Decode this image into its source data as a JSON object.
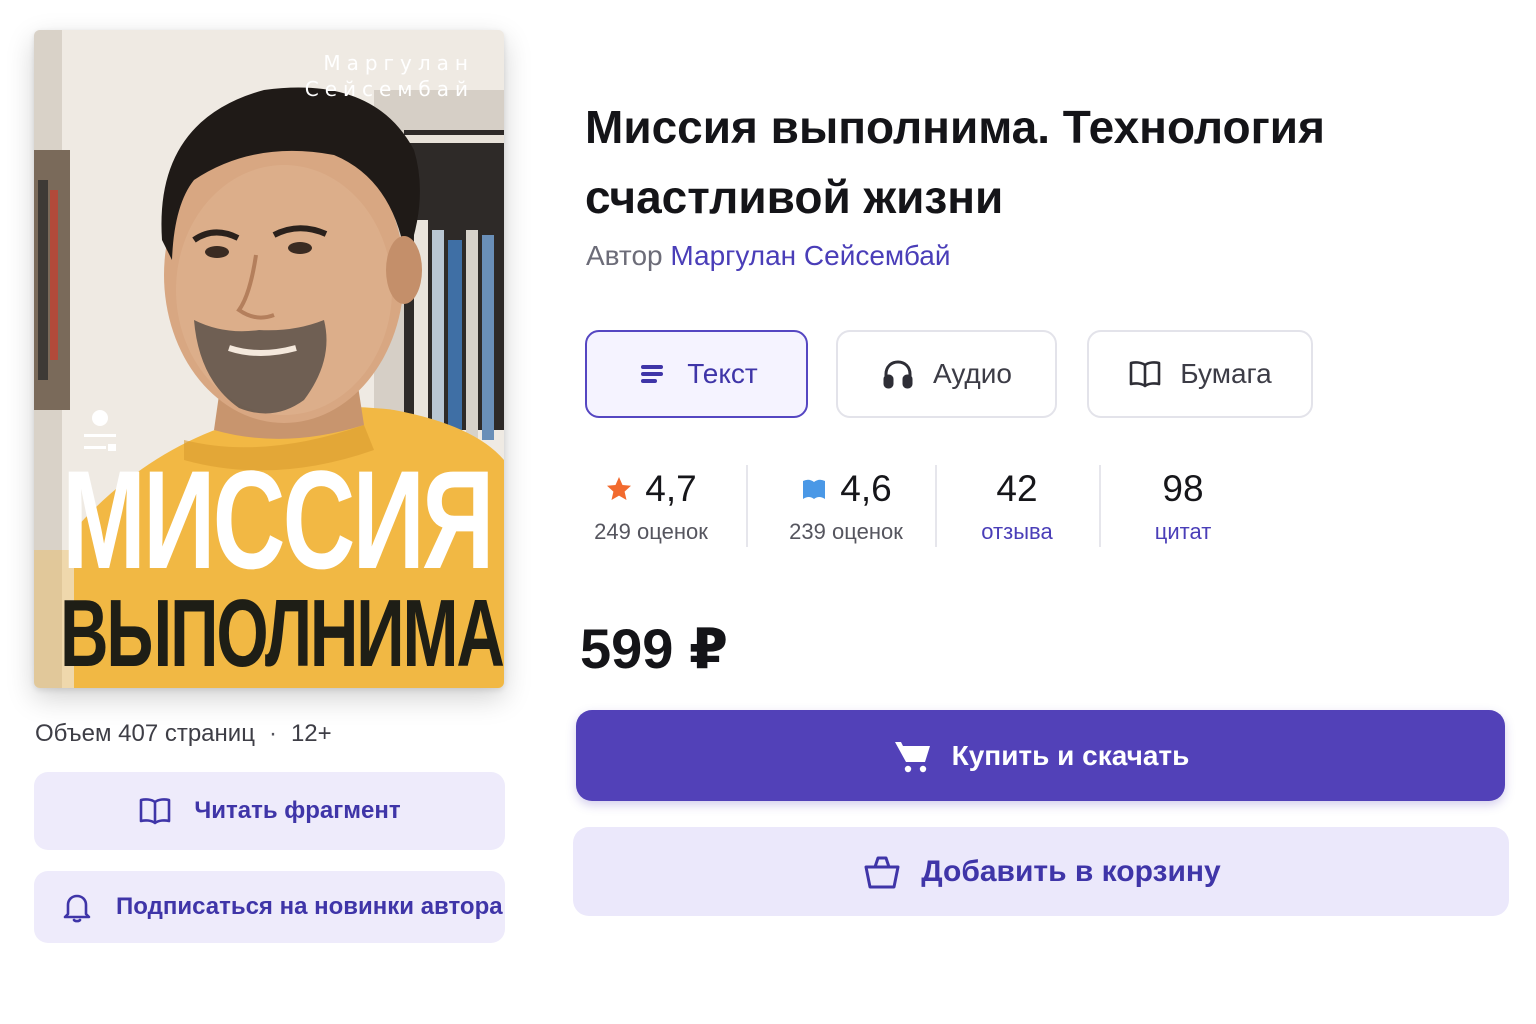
{
  "book": {
    "title": "Миссия выполнима. Технология счастливой жизни",
    "author_prefix": "Автор",
    "author_name": "Маргулан Сейсембай"
  },
  "cover": {
    "author_line_1": "Маргулан",
    "author_line_2": "Сейсембай",
    "title_line_1": "МИССИЯ",
    "title_line_2": "ВЫПОЛНИМА",
    "background_color": "#f2b844"
  },
  "meta": {
    "volume": "Объем 407 страниц",
    "separator": "·",
    "age_rating": "12+"
  },
  "side_actions": {
    "read_fragment": "Читать фрагмент",
    "subscribe": "Подписаться на новинки автора"
  },
  "formats": [
    {
      "label": "Текст",
      "icon": "lines-icon",
      "selected": true
    },
    {
      "label": "Аудио",
      "icon": "headphones-icon",
      "selected": false
    },
    {
      "label": "Бумага",
      "icon": "open-book-icon",
      "selected": false
    }
  ],
  "stats": {
    "rating_1": {
      "value": "4,7",
      "label": "249 оценок",
      "icon": "star-icon",
      "icon_color": "#f26a2e"
    },
    "rating_2": {
      "value": "4,6",
      "label": "239 оценок",
      "icon": "bookmark-icon",
      "icon_color": "#4a98e6"
    },
    "reviews": {
      "value": "42",
      "label": "отзыва"
    },
    "quotes": {
      "value": "98",
      "label": "цитат"
    }
  },
  "price": "599 ₽",
  "actions": {
    "buy": "Купить и скачать",
    "add_to_cart": "Добавить в корзину"
  },
  "colors": {
    "accent": "#5241b8",
    "accent_light": "#ebe8fb",
    "link": "#4a3eb8"
  }
}
